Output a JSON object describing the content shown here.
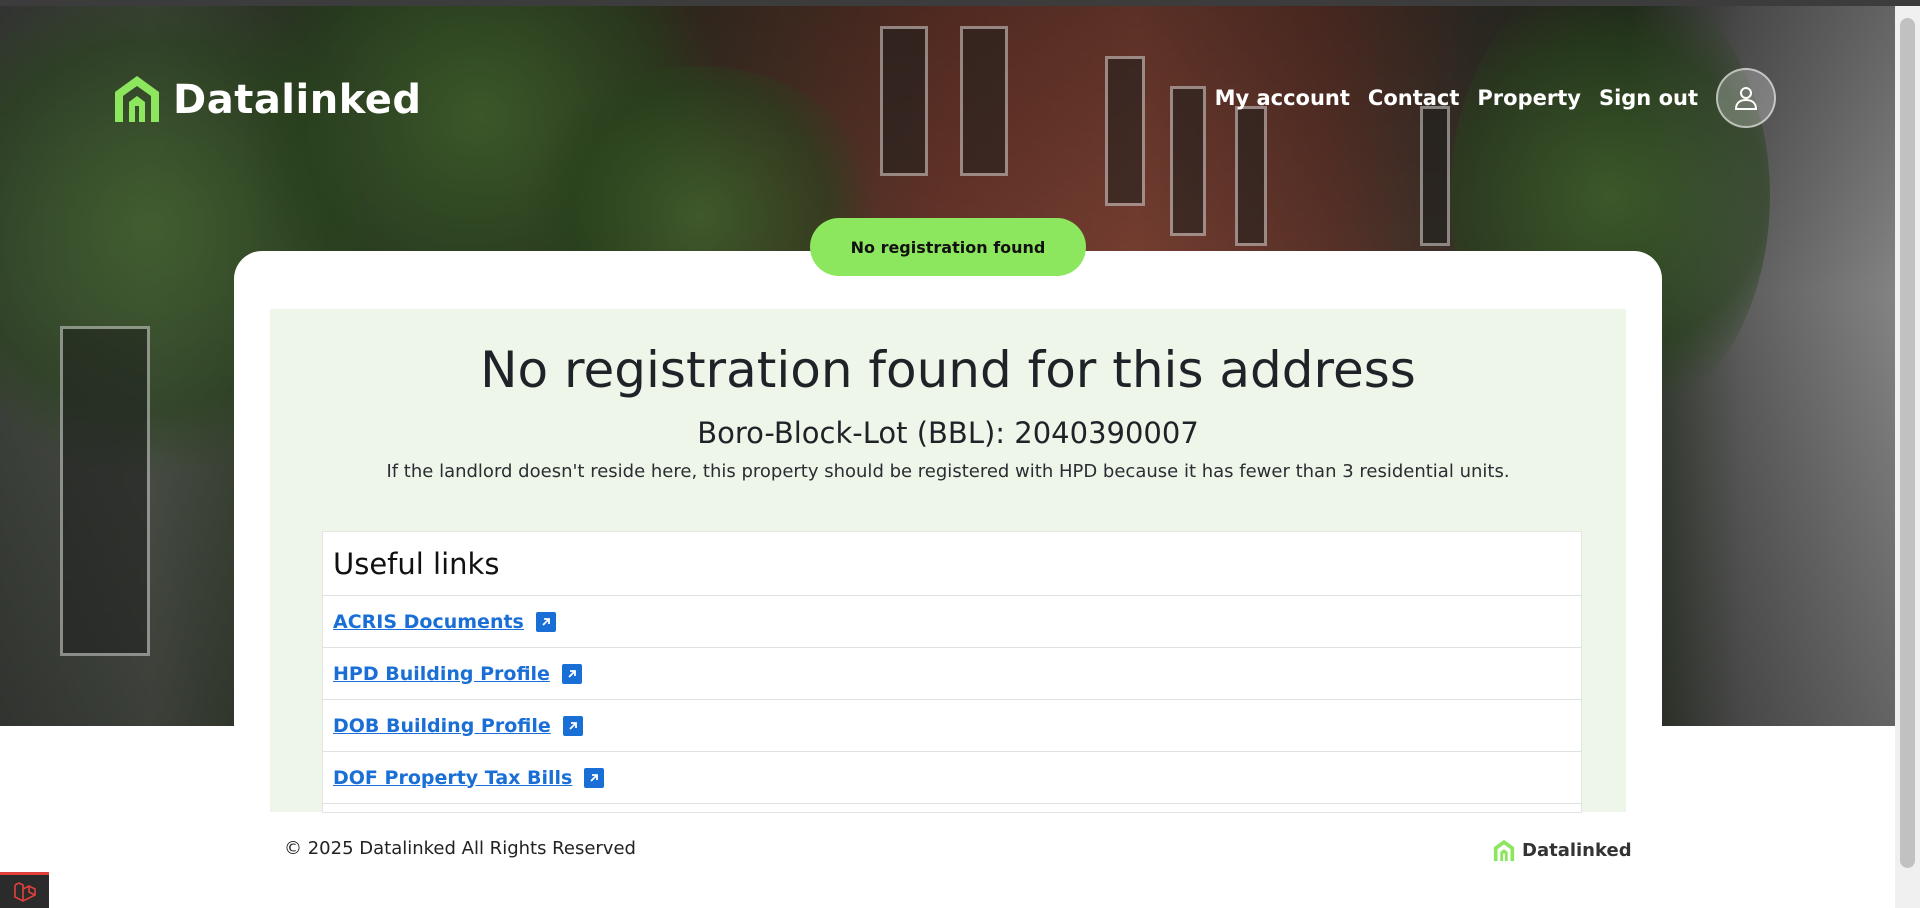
{
  "header": {
    "brand": "Datalinked",
    "nav": [
      "My account",
      "Contact",
      "Property",
      "Sign out"
    ]
  },
  "status_pill": "No registration found",
  "main": {
    "heading": "No registration found for this address",
    "bbl_label": "Boro-Block-Lot (BBL): ",
    "bbl_value": "2040390007",
    "notice": "If the landlord doesn't reside here, this property should be registered with HPD because it has fewer than 3 residential units.",
    "links_title": "Useful links",
    "links": [
      "ACRIS Documents",
      "HPD Building Profile",
      "DOB Building Profile",
      "DOF Property Tax Bills"
    ]
  },
  "footer": {
    "copyright": "© 2025 Datalinked All Rights Reserved",
    "brand": "Datalinked"
  },
  "colors": {
    "accent": "#8ce65e",
    "link": "#1a6fd6",
    "panel": "#eef5e9"
  }
}
